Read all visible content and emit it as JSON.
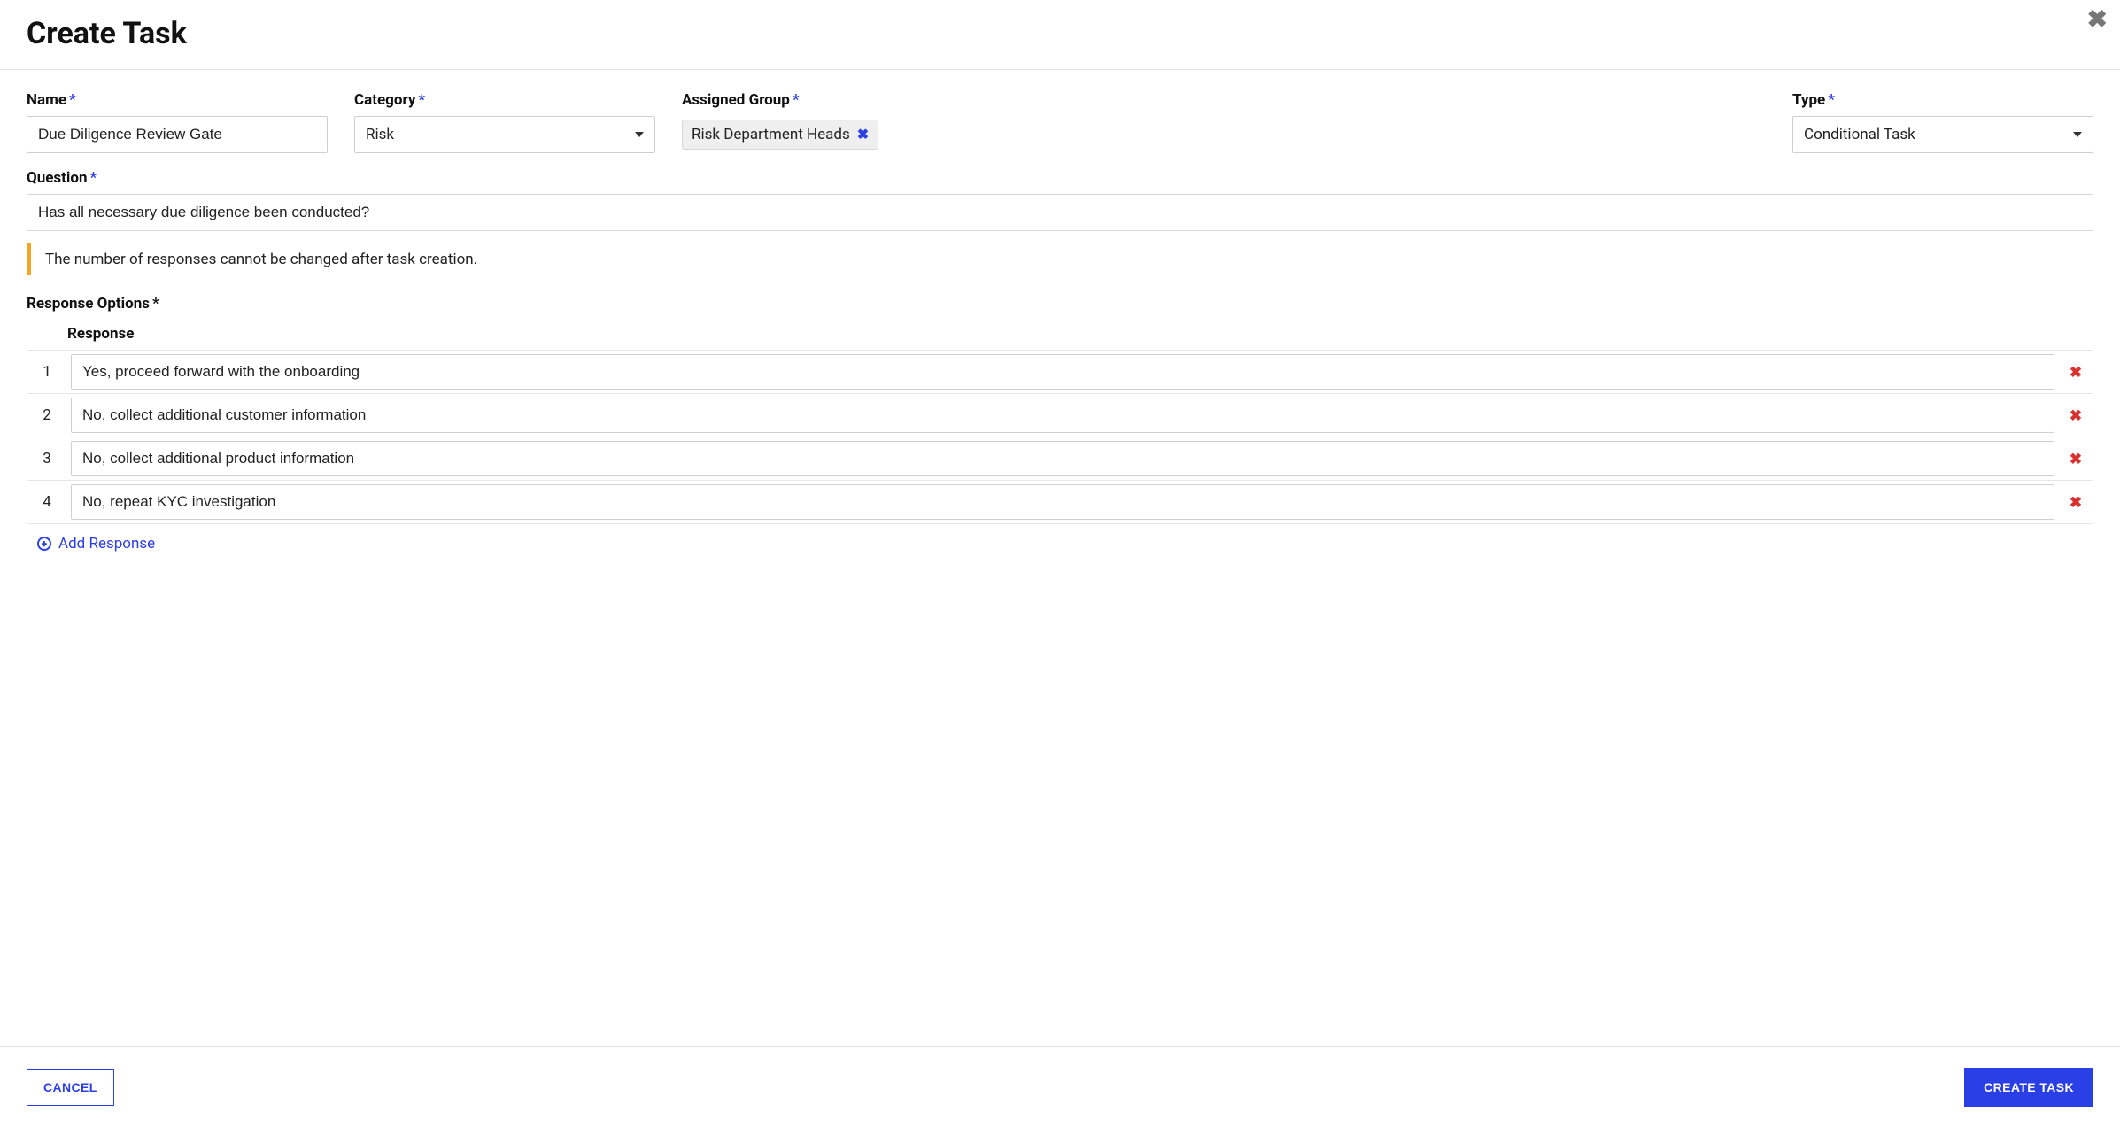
{
  "header": {
    "title": "Create Task"
  },
  "fields": {
    "name": {
      "label": "Name",
      "value": "Due Diligence Review Gate"
    },
    "category": {
      "label": "Category",
      "value": "Risk"
    },
    "assigned_group": {
      "label": "Assigned Group",
      "chip": "Risk Department Heads"
    },
    "type": {
      "label": "Type",
      "value": "Conditional Task"
    },
    "question": {
      "label": "Question",
      "value": "Has all necessary due diligence been conducted?"
    }
  },
  "alert": "The number of responses cannot be changed after task creation.",
  "responses": {
    "section_label": "Response Options",
    "column_header": "Response",
    "items": [
      {
        "num": "1",
        "text": "Yes, proceed forward with the onboarding"
      },
      {
        "num": "2",
        "text": "No, collect additional customer information"
      },
      {
        "num": "3",
        "text": "No, collect additional product information"
      },
      {
        "num": "4",
        "text": "No, repeat KYC investigation"
      }
    ],
    "add_label": "Add Response"
  },
  "footer": {
    "cancel": "CANCEL",
    "submit": "CREATE TASK"
  },
  "required_marker": "*"
}
